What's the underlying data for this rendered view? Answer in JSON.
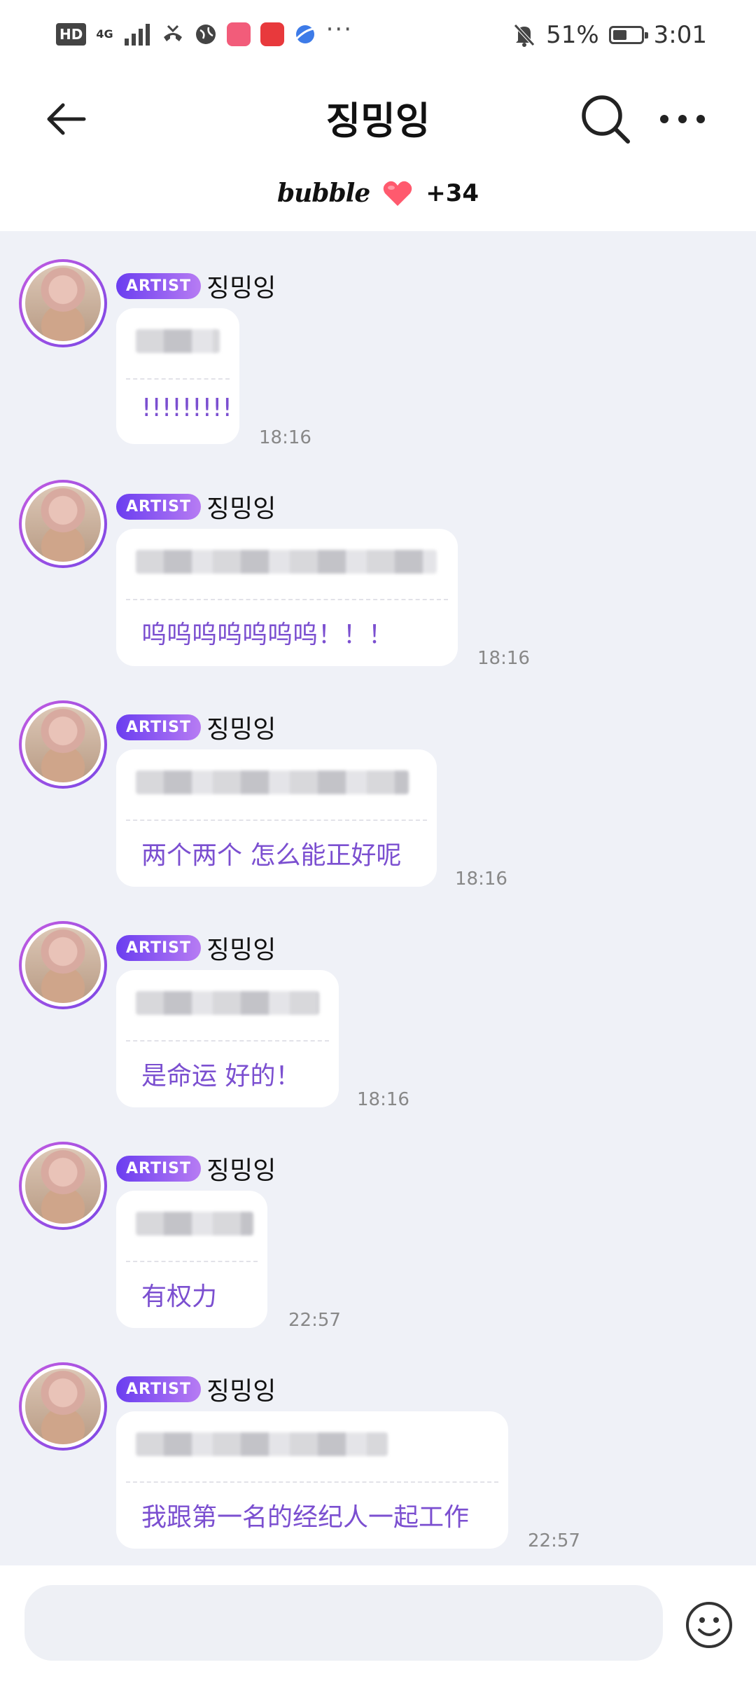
{
  "status_bar": {
    "hd": "HD",
    "network": "4G",
    "battery_percent": "51%",
    "battery_level": 0.51,
    "time": "3:01",
    "more": "···"
  },
  "header": {
    "title": "징밍잉",
    "bubble_label": "bubble",
    "plus_count": "+34"
  },
  "messages": [
    {
      "badge": "ARTIST",
      "name": "징밍잉",
      "translation": "!!!!!!!!!",
      "time": "18:16"
    },
    {
      "badge": "ARTIST",
      "name": "징밍잉",
      "translation": "呜呜呜呜呜呜呜！！！",
      "time": "18:16"
    },
    {
      "badge": "ARTIST",
      "name": "징밍잉",
      "translation": "两个两个 怎么能正好呢",
      "time": "18:16"
    },
    {
      "badge": "ARTIST",
      "name": "징밍잉",
      "translation": "是命运 好的！",
      "time": "18:16"
    },
    {
      "badge": "ARTIST",
      "name": "징밍잉",
      "translation": "有权力",
      "time": "22:57"
    },
    {
      "badge": "ARTIST",
      "name": "징밍잉",
      "translation": "我跟第一名的经纪人一起工作",
      "time": "22:57"
    }
  ],
  "input": {
    "placeholder": ""
  },
  "colors": {
    "accent": "#7b4fd0",
    "badge_start": "#6a3df0",
    "badge_end": "#b77cf3",
    "heart": "#ff5a6e",
    "chat_bg": "#eff1f7"
  },
  "icons": [
    "back-arrow-icon",
    "search-icon",
    "more-icon",
    "heart-icon",
    "smile-icon"
  ]
}
